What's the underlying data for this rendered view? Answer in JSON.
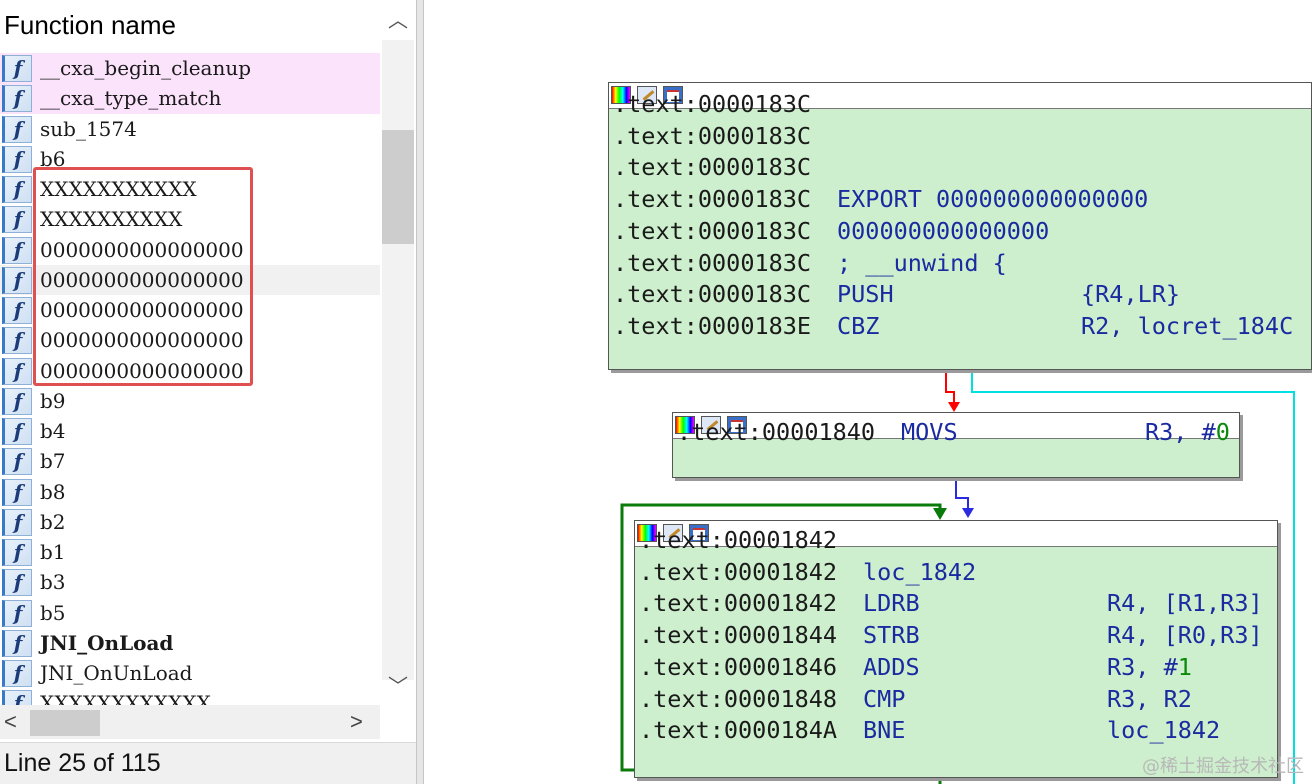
{
  "left_panel": {
    "header": "Function name",
    "icon_glyph": "f",
    "functions": [
      {
        "name": "__cxa_begin_cleanup"
      },
      {
        "name": "__cxa_type_match"
      },
      {
        "name": "sub_1574"
      },
      {
        "name": "b6"
      },
      {
        "name": "XXXXXXXXXXX"
      },
      {
        "name": "XXXXXXXXXX"
      },
      {
        "name": "0000000000000000"
      },
      {
        "name": "0000000000000000"
      },
      {
        "name": "0000000000000000"
      },
      {
        "name": "0000000000000000"
      },
      {
        "name": "0000000000000000"
      },
      {
        "name": "b9"
      },
      {
        "name": "b4"
      },
      {
        "name": "b7"
      },
      {
        "name": "b8"
      },
      {
        "name": "b2"
      },
      {
        "name": "b1"
      },
      {
        "name": "b3"
      },
      {
        "name": "b5"
      },
      {
        "name": "JNI_OnLoad"
      },
      {
        "name": "JNI_OnUnLoad"
      },
      {
        "name": "XXXXXXXXXXXX"
      }
    ],
    "status": "Line 25 of 115",
    "scroll_up_glyph": "︿",
    "scroll_down_glyph": "﹀",
    "scroll_left_glyph": "<",
    "scroll_right_glyph": ">"
  },
  "graph": {
    "block1": {
      "lines": [
        {
          "addr": ".text:0000183C",
          "mn": "",
          "op": "",
          "num": ""
        },
        {
          "addr": ".text:0000183C",
          "mn": "",
          "op": "",
          "num": ""
        },
        {
          "addr": ".text:0000183C",
          "mn": "",
          "op": "",
          "num": ""
        },
        {
          "addr": ".text:0000183C",
          "mn": "EXPORT 000000000000000",
          "op": "",
          "num": ""
        },
        {
          "addr": ".text:0000183C",
          "mn": "000000000000000",
          "op": "",
          "num": ""
        },
        {
          "addr": ".text:0000183C",
          "mn": "; __unwind {",
          "op": "",
          "num": ""
        },
        {
          "addr": ".text:0000183C",
          "mn": "PUSH",
          "op": "{R4,LR}",
          "num": ""
        },
        {
          "addr": ".text:0000183E",
          "mn": "CBZ",
          "op": "R2, locret_184C",
          "num": ""
        }
      ]
    },
    "block2": {
      "lines": [
        {
          "addr": ".text:00001840",
          "mn": "MOVS",
          "op": "R3, #",
          "num": "0"
        }
      ]
    },
    "block3": {
      "lines": [
        {
          "addr": ".text:00001842",
          "mn": "",
          "op": "",
          "num": ""
        },
        {
          "addr": ".text:00001842",
          "mn": "loc_1842",
          "op": "",
          "num": ""
        },
        {
          "addr": ".text:00001842",
          "mn": "LDRB",
          "op": "R4, [R1,R3]",
          "num": ""
        },
        {
          "addr": ".text:00001844",
          "mn": "STRB",
          "op": "R4, [R0,R3]",
          "num": ""
        },
        {
          "addr": ".text:00001846",
          "mn": "ADDS",
          "op": "R3, #",
          "num": "1"
        },
        {
          "addr": ".text:00001848",
          "mn": "CMP",
          "op": "R3, R2",
          "num": ""
        },
        {
          "addr": ".text:0000184A",
          "mn": "BNE",
          "op": "loc_1842",
          "num": ""
        }
      ]
    },
    "colors": {
      "node_bg": "#cdefcd",
      "edge_false": "#ff0000",
      "edge_true": "#00e0e0",
      "edge_flow": "#2a2ae0",
      "edge_loop": "#0a7a0a"
    }
  },
  "watermark": "@稀土掘金技术社区"
}
